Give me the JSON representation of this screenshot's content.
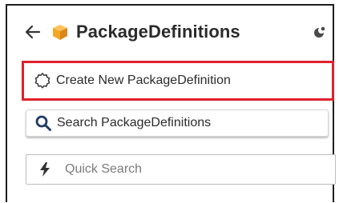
{
  "header": {
    "title": "PackageDefinitions",
    "back_icon": "arrow-left-icon",
    "entity_icon": "package-box-icon",
    "theme_icon": "theme-toggle-icon"
  },
  "actions": {
    "create_label": "Create New PackageDefinition",
    "create_icon": "gear-outline-icon",
    "search_label": "Search PackageDefinitions",
    "search_icon": "magnifier-icon"
  },
  "quick_search": {
    "placeholder": "Quick Search",
    "value": "",
    "icon": "lightning-bolt-icon"
  },
  "colors": {
    "highlight": "#e0202b",
    "package_icon": "#f5a623",
    "text": "#2b2b2b"
  }
}
